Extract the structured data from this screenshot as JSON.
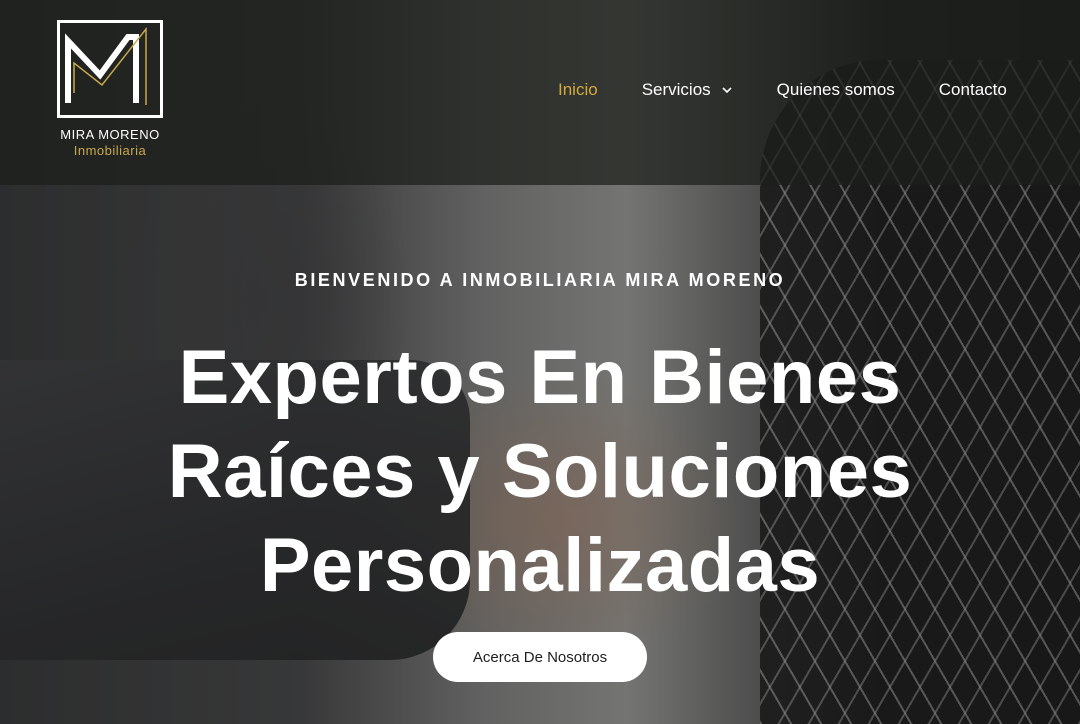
{
  "brand": {
    "name": "MIRA MORENO",
    "tagline": "Inmobiliaria",
    "accent_color": "#d4a93c"
  },
  "nav": {
    "items": [
      {
        "label": "Inicio",
        "active": true
      },
      {
        "label": "Servicios",
        "has_dropdown": true,
        "icon": "chevron-down-icon"
      },
      {
        "label": "Quienes somos"
      },
      {
        "label": "Contacto"
      }
    ]
  },
  "hero": {
    "eyebrow": "BIENVENIDO A INMOBILIARIA MIRA MORENO",
    "headline_lines": [
      "Expertos En Bienes",
      "Raíces y Soluciones",
      "Personalizadas"
    ],
    "cta_label": "Acerca De Nosotros"
  }
}
